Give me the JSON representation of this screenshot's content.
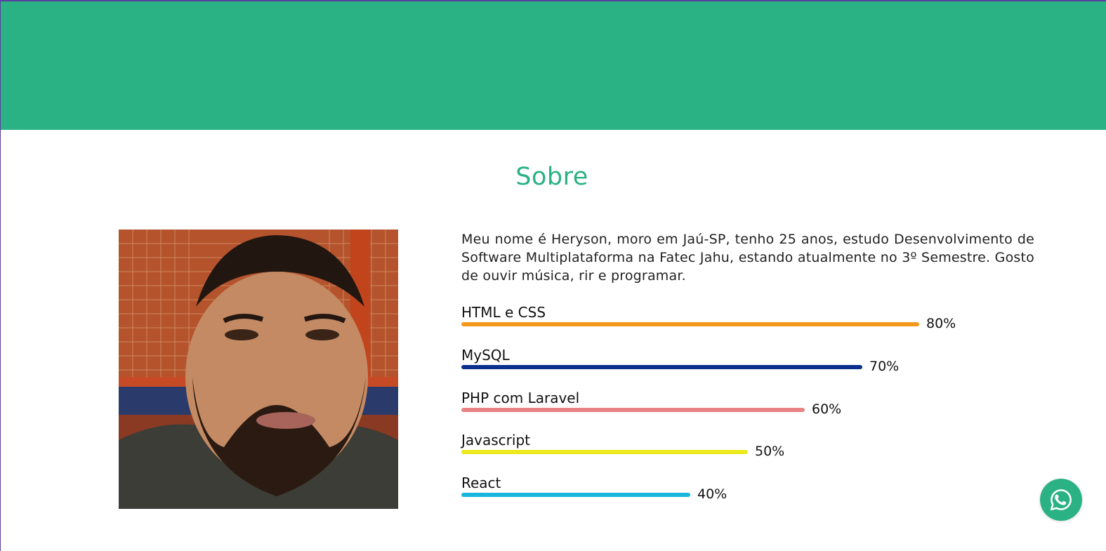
{
  "about": {
    "title": "Sobre",
    "text": "Meu nome é Heryson, moro em Jaú-SP, tenho 25 anos, estudo Desenvolvimento de Software Multiplataforma na Fatec Jahu, estando atualmente no 3º Semestre. Gosto de ouvir música, rir e programar."
  },
  "skills": [
    {
      "name": "HTML e CSS",
      "percent": 80,
      "percent_label": "80%",
      "color": "#f39a1d"
    },
    {
      "name": "MySQL",
      "percent": 70,
      "percent_label": "70%",
      "color": "#0a2f8c"
    },
    {
      "name": "PHP com Laravel",
      "percent": 60,
      "percent_label": "60%",
      "color": "#e88283"
    },
    {
      "name": "Javascript",
      "percent": 50,
      "percent_label": "50%",
      "color": "#ece91c"
    },
    {
      "name": "React",
      "percent": 40,
      "percent_label": "40%",
      "color": "#18b5dc"
    }
  ],
  "colors": {
    "brand": "#2ab184",
    "page_border": "#5a3fa0"
  },
  "whatsapp": {
    "icon": "whatsapp-icon"
  }
}
